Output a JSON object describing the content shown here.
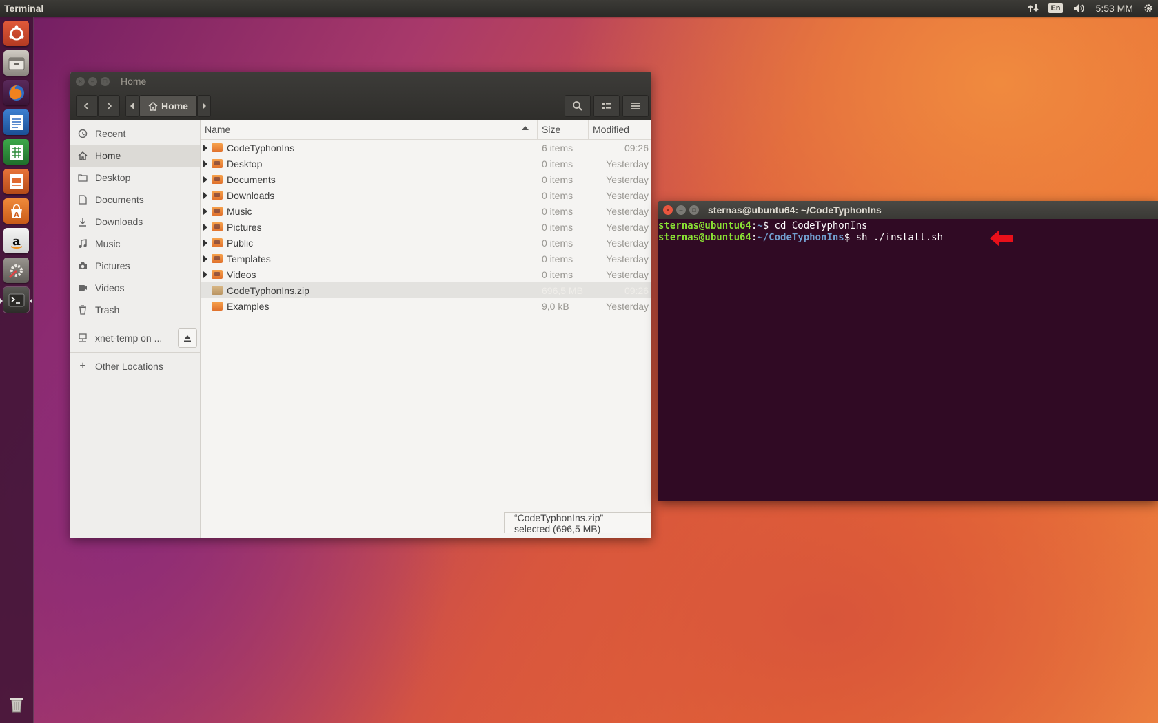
{
  "top_panel": {
    "title": "Terminal",
    "lang_indicator": "En",
    "clock": "5:53 MM"
  },
  "launcher": {
    "items": [
      "ubuntu-dash-icon",
      "files-icon",
      "firefox-icon",
      "writer-icon",
      "calc-icon",
      "impress-icon",
      "software-center-icon",
      "amazon-icon",
      "system-settings-icon",
      "terminal-icon",
      "trash-icon"
    ]
  },
  "file_manager": {
    "title": "Home",
    "breadcrumb": "Home",
    "sidebar": {
      "items": [
        {
          "label": "Recent",
          "icon": "clock-icon"
        },
        {
          "label": "Home",
          "icon": "home-icon"
        },
        {
          "label": "Desktop",
          "icon": "folder-icon"
        },
        {
          "label": "Documents",
          "icon": "document-icon"
        },
        {
          "label": "Downloads",
          "icon": "download-icon"
        },
        {
          "label": "Music",
          "icon": "music-icon"
        },
        {
          "label": "Pictures",
          "icon": "camera-icon"
        },
        {
          "label": "Videos",
          "icon": "video-icon"
        },
        {
          "label": "Trash",
          "icon": "trash-icon"
        }
      ],
      "network": "xnet-temp on ...",
      "other": "Other Locations"
    },
    "columns": {
      "name": "Name",
      "size": "Size",
      "modified": "Modified"
    },
    "rows": [
      {
        "name": "CodeTyphonIns",
        "size": "6 items",
        "modified": "09:26"
      },
      {
        "name": "Desktop",
        "size": "0 items",
        "modified": "Yesterday"
      },
      {
        "name": "Documents",
        "size": "0 items",
        "modified": "Yesterday"
      },
      {
        "name": "Downloads",
        "size": "0 items",
        "modified": "Yesterday"
      },
      {
        "name": "Music",
        "size": "0 items",
        "modified": "Yesterday"
      },
      {
        "name": "Pictures",
        "size": "0 items",
        "modified": "Yesterday"
      },
      {
        "name": "Public",
        "size": "0 items",
        "modified": "Yesterday"
      },
      {
        "name": "Templates",
        "size": "0 items",
        "modified": "Yesterday"
      },
      {
        "name": "Videos",
        "size": "0 items",
        "modified": "Yesterday"
      },
      {
        "name": "CodeTyphonIns.zip",
        "size": "696,5 MB",
        "modified": "09:26"
      },
      {
        "name": "Examples",
        "size": "9,0 kB",
        "modified": "Yesterday"
      }
    ],
    "status": "“CodeTyphonIns.zip” selected  (696,5 MB)"
  },
  "terminal": {
    "title": "sternas@ubuntu64: ~/CodeTyphonIns",
    "lines": [
      {
        "user": "sternas@ubuntu64",
        "path": "~",
        "command": "cd CodeTyphonIns"
      },
      {
        "user": "sternas@ubuntu64",
        "path": "~/CodeTyphonIns",
        "command": "sh ./install.sh"
      }
    ]
  }
}
